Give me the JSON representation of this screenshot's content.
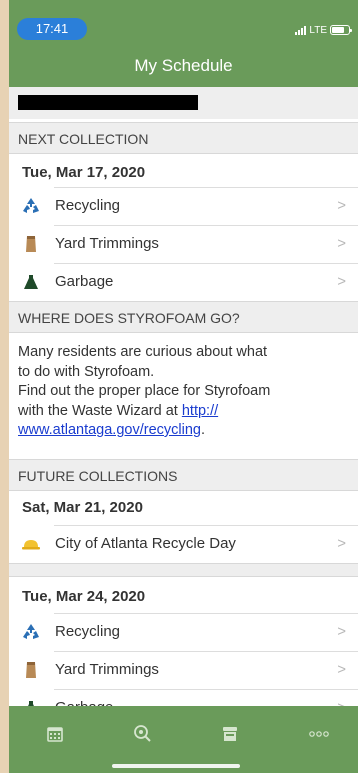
{
  "status_bar": {
    "time": "17:41",
    "network": "LTE"
  },
  "header": {
    "title": "My Schedule"
  },
  "next_collection": {
    "header": "NEXT COLLECTION",
    "date": "Tue, Mar 17, 2020",
    "items": [
      {
        "label": "Recycling",
        "icon": "recycling-icon"
      },
      {
        "label": "Yard Trimmings",
        "icon": "yard-trimmings-icon"
      },
      {
        "label": "Garbage",
        "icon": "garbage-icon"
      }
    ]
  },
  "styrofoam": {
    "header": "WHERE DOES STYROFOAM GO?",
    "line1": "Many residents are curious about what",
    "line2": "to do with Styrofoam.",
    "line3": "Find out the proper place for Styrofoam",
    "line4_prefix": "with the Waste Wizard at ",
    "link_part1": "http://",
    "link_part2": "www.atlantaga.gov/recycling",
    "line5_suffix": "."
  },
  "future_collections": {
    "header": "FUTURE COLLECTIONS",
    "groups": [
      {
        "date": "Sat, Mar 21, 2020",
        "items": [
          {
            "label": "City of Atlanta Recycle Day",
            "icon": "hard-hat-icon"
          }
        ]
      },
      {
        "date": "Tue, Mar 24, 2020",
        "items": [
          {
            "label": "Recycling",
            "icon": "recycling-icon"
          },
          {
            "label": "Yard Trimmings",
            "icon": "yard-trimmings-icon"
          },
          {
            "label": "Garbage",
            "icon": "garbage-icon"
          }
        ]
      }
    ]
  },
  "chevron": ">",
  "tabs": [
    {
      "name": "calendar",
      "icon": "calendar-icon"
    },
    {
      "name": "search",
      "icon": "search-icon"
    },
    {
      "name": "bin",
      "icon": "bin-icon"
    },
    {
      "name": "more",
      "icon": "more-icon"
    }
  ],
  "colors": {
    "brand_green": "#6a9b5a",
    "recycling_blue": "#2a6fb5",
    "yard_tan": "#b88a56",
    "garbage_green": "#1f4a2a",
    "hardhat_yellow": "#f2c230",
    "link_blue": "#1a3ccf"
  }
}
